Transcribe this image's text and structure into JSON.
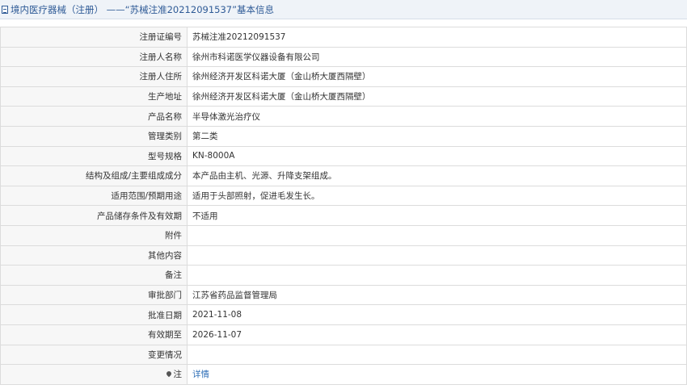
{
  "header": {
    "icon": "document-icon",
    "title": "境内医疗器械（注册） ——“苏械注准20212091537”基本信息"
  },
  "rows": [
    {
      "label": "注册证编号",
      "value": "苏械注准20212091537"
    },
    {
      "label": "注册人名称",
      "value": "徐州市科诺医学仪器设备有限公司"
    },
    {
      "label": "注册人住所",
      "value": "徐州经济开发区科诺大厦（金山桥大厦西隔壁）"
    },
    {
      "label": "生产地址",
      "value": "徐州经济开发区科诺大厦（金山桥大厦西隔壁）"
    },
    {
      "label": "产品名称",
      "value": "半导体激光治疗仪"
    },
    {
      "label": "管理类别",
      "value": "第二类"
    },
    {
      "label": "型号规格",
      "value": "KN-8000A"
    },
    {
      "label": "结构及组成/主要组成成分",
      "value": "本产品由主机、光源、升降支架组成。"
    },
    {
      "label": "适用范围/预期用途",
      "value": "适用于头部照射，促进毛发生长。"
    },
    {
      "label": "产品储存条件及有效期",
      "value": "不适用"
    },
    {
      "label": "附件",
      "value": ""
    },
    {
      "label": "其他内容",
      "value": ""
    },
    {
      "label": "备注",
      "value": ""
    },
    {
      "label": "审批部门",
      "value": "江苏省药品监督管理局"
    },
    {
      "label": "批准日期",
      "value": "2021-11-08"
    },
    {
      "label": "有效期至",
      "value": "2026-11-07"
    },
    {
      "label": "变更情况",
      "value": ""
    }
  ],
  "note_row": {
    "icon": "pin-icon",
    "label": "注",
    "link_text": "详情"
  }
}
